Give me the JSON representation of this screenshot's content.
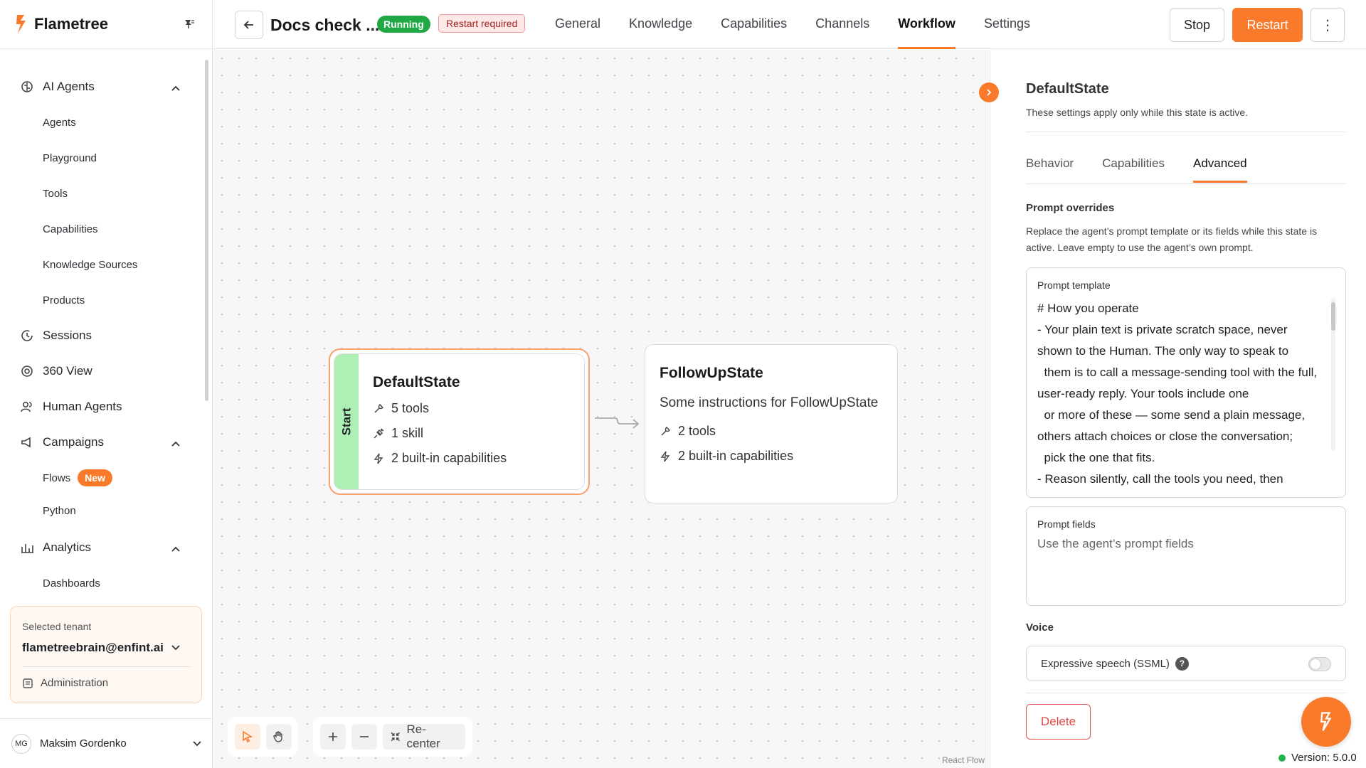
{
  "brand": {
    "name": "Flametree"
  },
  "sidebar": {
    "sections": [
      {
        "label": "AI Agents",
        "icon": "brain-icon"
      },
      {
        "label": "Sessions",
        "icon": "history-icon"
      },
      {
        "label": "360 View",
        "icon": "donut-icon"
      },
      {
        "label": "Human Agents",
        "icon": "users-icon"
      },
      {
        "label": "Campaigns",
        "icon": "megaphone-icon"
      },
      {
        "label": "Analytics",
        "icon": "bar-chart-icon"
      }
    ],
    "ai_agents_items": [
      "Agents",
      "Playground",
      "Tools",
      "Capabilities",
      "Knowledge Sources",
      "Products"
    ],
    "campaigns_items": [
      "Flows",
      "Python"
    ],
    "flows_badge": "New",
    "analytics_items": [
      "Dashboards"
    ],
    "tenant": {
      "label": "Selected tenant",
      "value": "flametreebrain@enfint.ai",
      "admin": "Administration"
    },
    "user": {
      "initials": "MG",
      "name": "Maksim Gordenko"
    }
  },
  "header": {
    "title": "Docs check ...",
    "status": "Running",
    "restart_badge": "Restart required",
    "tabs": [
      "General",
      "Knowledge",
      "Capabilities",
      "Channels",
      "Workflow",
      "Settings"
    ],
    "active_tab": "Workflow",
    "stop_label": "Stop",
    "restart_label": "Restart",
    "more_label": "⋮"
  },
  "canvas": {
    "nodes": {
      "default": {
        "start_label": "Start",
        "title": "DefaultState",
        "tools": "5 tools",
        "skills": "1 skill",
        "builtins": "2 built-in capabilities"
      },
      "followup": {
        "title": "FollowUpState",
        "description": "Some instructions for FollowUpState",
        "tools": "2 tools",
        "builtins": "2 built-in capabilities"
      }
    },
    "recenter_label": "Re-center",
    "attribution": "React Flow"
  },
  "panel": {
    "title": "DefaultState",
    "subtitle": "These settings apply only while this state is active.",
    "tabs": [
      "Behavior",
      "Capabilities",
      "Advanced"
    ],
    "active_tab": "Advanced",
    "prompt_overrides": {
      "title": "Prompt overrides",
      "description": "Replace the agent’s prompt template or its fields while this state is active. Leave empty to use the agent’s own prompt."
    },
    "prompt_template": {
      "label": "Prompt template",
      "value": "# How you operate\n- Your plain text is private scratch space, never shown to the Human. The only way to speak to\n  them is to call a message-sending tool with the full, user-ready reply. Your tools include one\n  or more of these — some send a plain message, others attach choices or close the conversation;\n  pick the one that fits.\n- Reason silently, call the tools you need, then"
    },
    "prompt_fields": {
      "label": "Prompt fields",
      "placeholder": "Use the agent’s prompt fields"
    },
    "voice": {
      "title": "Voice",
      "ssml_label": "Expressive speech (SSML)",
      "ssml_enabled": false
    },
    "delete_label": "Delete"
  },
  "footer": {
    "version": "Version: 5.0.0"
  },
  "colors": {
    "accent": "#f97a2b",
    "running": "#1fa844",
    "start_strip": "#aef0b3",
    "danger": "#e04848"
  }
}
